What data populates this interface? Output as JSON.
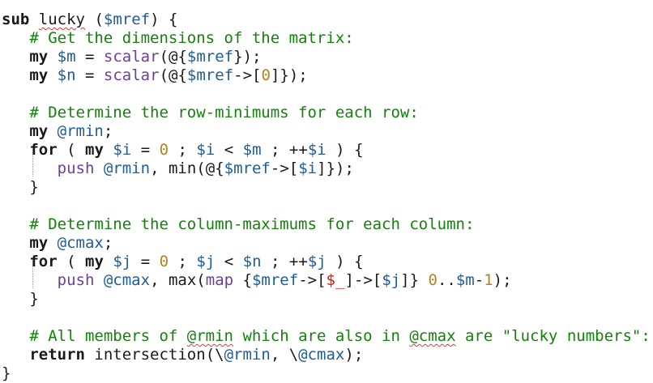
{
  "editor": {
    "lines": [
      "",
      "sub lucky ($mref) {",
      "   # Get the dimensions of the matrix:",
      "   my $m = scalar(@{$mref});",
      "   my $n = scalar(@{$mref->[0]});",
      "",
      "   # Determine the row-minimums for each row:",
      "   my @rmin;",
      "   for ( my $i = 0 ; $i < $m ; ++$i ) {",
      "      push @rmin, min(@{$mref->[$i]});",
      "   }",
      "",
      "   # Determine the column-maximums for each column:",
      "   my @cmax;",
      "   for ( my $j = 0 ; $j < $n ; ++$j ) {",
      "      push @cmax, max(map {$mref->[$_]->[$j]} 0..$m-1);",
      "   }",
      "",
      "   # All members of @rmin which are also in @cmax are \"lucky numbers\":",
      "   return intersection(\\@rmin, \\@cmax);",
      "}"
    ]
  },
  "colors": {
    "keyword": "#1a1a1a",
    "comment": "#13820a",
    "variable": "#1f5c99",
    "function": "#6b3fa0",
    "number": "#b5821f",
    "special_var": "#c0261f",
    "spellcheck_underline": "#d43a3a",
    "background": "#ffffff"
  }
}
